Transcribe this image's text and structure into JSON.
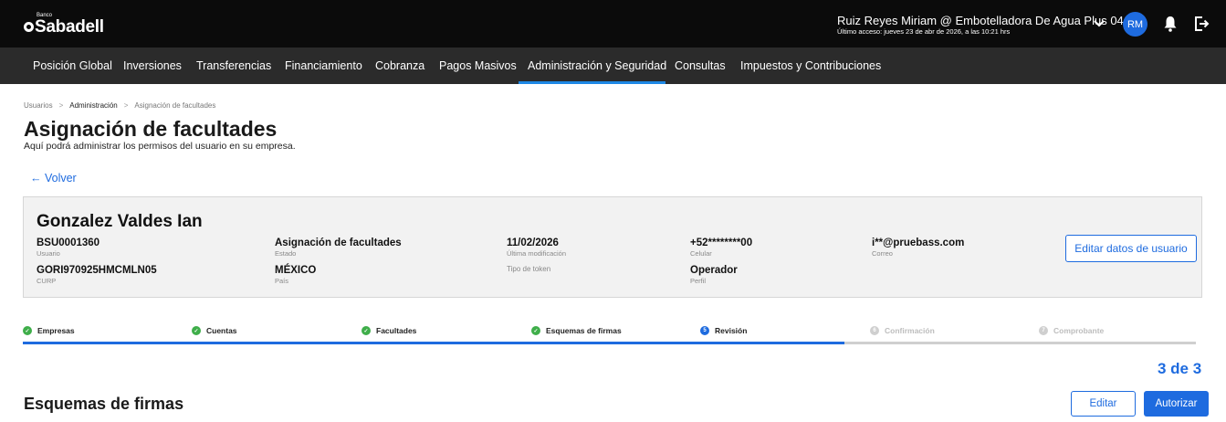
{
  "header": {
    "logo_small": "Banco",
    "logo_name": "Sabadell",
    "user_name": "Ruiz Reyes Miriam @ Embotelladora De Agua Plus 04",
    "last_access": "Último acceso: jueves 23 de abr de 2026, a las 10:21 hrs",
    "avatar_initials": "RM",
    "icons": [
      "chevron-down-icon",
      "bell-icon",
      "logout-icon"
    ]
  },
  "nav": {
    "items": [
      {
        "label": "Posición Global"
      },
      {
        "label": "Inversiones"
      },
      {
        "label": "Transferencias"
      },
      {
        "label": "Financiamiento"
      },
      {
        "label": "Cobranza"
      },
      {
        "label": "Pagos Masivos"
      },
      {
        "label": "Administración y Seguridad",
        "active": true
      },
      {
        "label": "Consultas"
      },
      {
        "label": "Impuestos y Contribuciones"
      }
    ]
  },
  "breadcrumb": [
    "Usuarios",
    "Administración",
    "Asignación de facultades"
  ],
  "page": {
    "title": "Asignación de facultades",
    "subtitle": "Aquí podrá administrar los permisos del usuario en su empresa.",
    "back_label": "← Volver"
  },
  "user_card": {
    "name": "Gonzalez Valdes Ian",
    "usuario_value": "BSU0001360",
    "usuario_label": "Usuario",
    "curp_value": "GORI970925HMCMLN05",
    "curp_label": "CURP",
    "estado_value": "Asignación de facultades",
    "estado_label": "Estado",
    "pais_value": "MÉXICO",
    "pais_label": "País",
    "modificacion_value": "11/02/2026",
    "modificacion_label": "Última modificación",
    "token_label": "Tipo de token",
    "celular_value": "+52********00",
    "celular_label": "Celular",
    "perfil_value": "Operador",
    "perfil_label": "Perfil",
    "correo_value": "i**@pruebass.com",
    "correo_label": "Correo",
    "edit_button": "Editar datos de usuario"
  },
  "steps": [
    {
      "label": "Empresas",
      "status": "done",
      "marker": "✓"
    },
    {
      "label": "Cuentas",
      "status": "done",
      "marker": "✓"
    },
    {
      "label": "Facultades",
      "status": "done",
      "marker": "✓"
    },
    {
      "label": "Esquemas de firmas",
      "status": "done",
      "marker": "✓"
    },
    {
      "label": "Revisión",
      "status": "current",
      "marker": "5"
    },
    {
      "label": "Confirmación",
      "status": "pending",
      "marker": "6"
    },
    {
      "label": "Comprobante",
      "status": "pending",
      "marker": "7"
    }
  ],
  "progress": {
    "completed_fraction": 0.7
  },
  "counter": "3 de 3",
  "section": {
    "title": "Esquemas de firmas",
    "edit_button": "Editar",
    "authorize_button": "Autorizar"
  },
  "colors": {
    "accent": "#1e6bdf",
    "done": "#3fae4a",
    "topbar": "#0b0b0b",
    "navbar": "#2b2b2b"
  }
}
